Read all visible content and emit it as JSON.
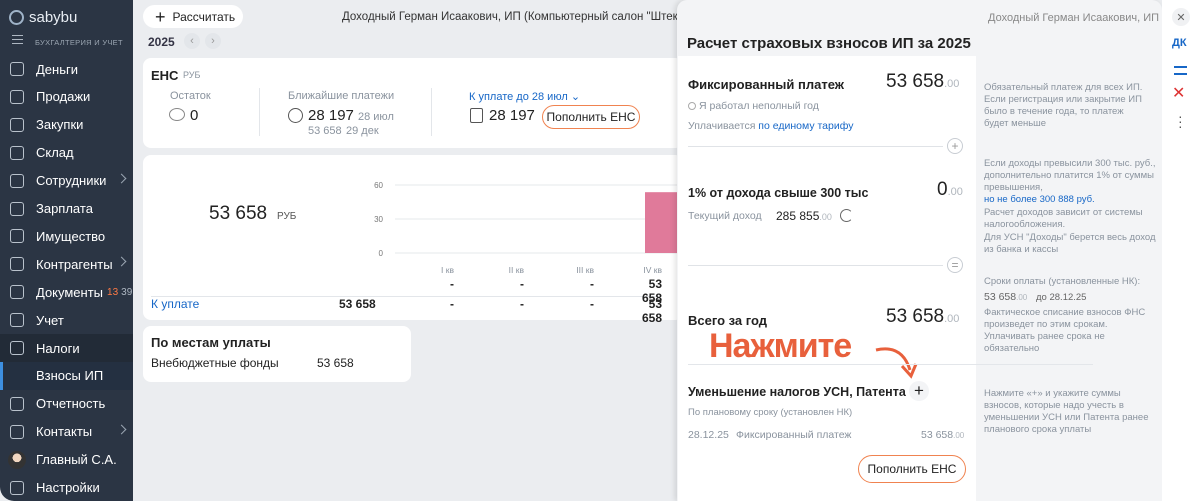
{
  "app": {
    "logo": "sabybu",
    "subtitle": "БУХГАЛТЕРИЯ И УЧЕТ"
  },
  "nav": [
    {
      "label": "Деньги",
      "icon": "money-icon",
      "chevron": false
    },
    {
      "label": "Продажи",
      "icon": "sales-icon",
      "chevron": false
    },
    {
      "label": "Закупки",
      "icon": "purchases-icon",
      "chevron": false
    },
    {
      "label": "Склад",
      "icon": "warehouse-icon",
      "chevron": false
    },
    {
      "label": "Сотрудники",
      "icon": "employees-icon",
      "chevron": true
    },
    {
      "label": "Зарплата",
      "icon": "salary-icon",
      "chevron": false
    },
    {
      "label": "Имущество",
      "icon": "property-icon",
      "chevron": false
    },
    {
      "label": "Контрагенты",
      "icon": "contractors-icon",
      "chevron": true
    },
    {
      "label": "Документы",
      "icon": "documents-icon",
      "chevron": false,
      "badge1": "13",
      "badge2": "39"
    },
    {
      "label": "Учет",
      "icon": "accounting-icon",
      "chevron": false
    },
    {
      "label": "Налоги",
      "icon": "taxes-icon",
      "chevron": false,
      "active": true
    },
    {
      "label": "Взносы ИП",
      "sub": true
    },
    {
      "label": "Отчетность",
      "icon": "reports-icon",
      "chevron": false
    },
    {
      "label": "Контакты",
      "icon": "contacts-icon",
      "chevron": true
    },
    {
      "label": "Главный С.А.",
      "avatar": true
    },
    {
      "label": "Настройки",
      "icon": "settings-icon",
      "chevron": false
    }
  ],
  "top": {
    "calc_button": "Рассчитать",
    "org": "Доходный Герман Исаакович, ИП (Компьютерный салон \"Штекер\")",
    "year": "2025"
  },
  "ens": {
    "title": "ЕНС",
    "currency": "РУБ",
    "balance_label": "Остаток",
    "balance_value": "0",
    "upcoming_label": "Ближайшие платежи",
    "upcoming_value": "28 197",
    "upcoming_date": "28 июл",
    "upcoming_value2": "53 658",
    "upcoming_date2": "29 дек",
    "due_label": "К уплате до 28 июл",
    "due_value": "28 197",
    "topup_button": "Пополнить ЕНС"
  },
  "summary": {
    "total": "53 658",
    "currency": "РУБ",
    "due_label": "К уплате",
    "due_total": "53 658",
    "quarters": [
      "I кв",
      "II кв",
      "III кв",
      "IV кв"
    ],
    "row1": [
      "-",
      "-",
      "-",
      "53 658"
    ],
    "row2": [
      "-",
      "-",
      "-",
      "53 658"
    ]
  },
  "chart_data": {
    "type": "bar",
    "categories": [
      "I кв",
      "II кв",
      "III кв",
      "IV кв"
    ],
    "values": [
      0,
      0,
      0,
      53658
    ],
    "yticks": [
      "0",
      "30",
      "60"
    ],
    "ylim": [
      0,
      60000
    ],
    "color": "#e07a9a"
  },
  "places": {
    "title": "По местам уплаты",
    "item_label": "Внебюджетные фонды",
    "item_value": "53 658"
  },
  "panel": {
    "header_org": "Доходный Герман Исаакович, ИП",
    "title": "Расчет страховых взносов ИП за 2025",
    "fixed": {
      "label": "Фиксированный платеж",
      "value": "53 658",
      "cents": ".00",
      "checkbox": "Я работал неполный год",
      "paid_prefix": "Уплачивается",
      "paid_link": "по единому тарифу"
    },
    "fixed_note": "Обязательный платеж для всех ИП. Если регистрация или закрытие ИП было в течение года, то платеж будет меньше",
    "percent": {
      "label": "1% от дохода свыше 300 тыс",
      "value": "0",
      "cents": ".00",
      "income_label": "Текущий доход",
      "income_value": "285 855",
      "income_cents": ".00"
    },
    "percent_note1": "Если доходы превысили 300 тыс. руб., дополнительно платится 1% от суммы превышения,",
    "percent_note_link": "но не более 300 888 руб.",
    "percent_note2": "Расчет доходов зависит от системы налогообложения.",
    "percent_note3": "Для УСН \"Доходы\" берется весь доход из банка и кассы",
    "deadline_note_title": "Сроки оплаты (установленные НК):",
    "deadline_value": "53 658",
    "deadline_cents": ".00",
    "deadline_date": "до 28.12.25",
    "deadline_note": "Фактическое списание взносов ФНС произведет по этим срокам. Уплачивать ранее срока не обязательно",
    "total": {
      "label": "Всего за год",
      "value": "53 658",
      "cents": ".00"
    },
    "annotation": "Нажмите",
    "reduce": {
      "label": "Уменьшение налогов УСН, Патента",
      "sublabel": "По плановому сроку (установлен НК)",
      "row_date": "28.12.25",
      "row_name": "Фиксированный платеж",
      "row_value": "53 658",
      "row_cents": ".00"
    },
    "reduce_note": "Нажмите «+» и укажите суммы взносов, которые надо учесть в уменьшении УСН или Патента ранее планового срока уплаты",
    "topup_button": "Пополнить ЕНС"
  },
  "toolbar": {
    "dk": "ДК"
  }
}
